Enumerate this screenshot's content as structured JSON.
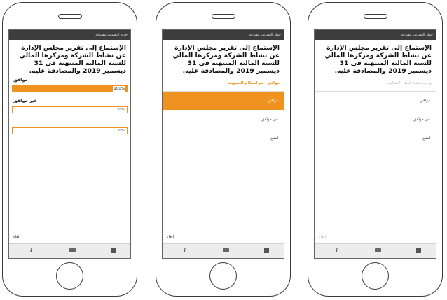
{
  "header_title": "جولة التصويت مفتوحة",
  "question": "الإستماع إلى تقرير مجلس الإدارة عن نشاط الشركة ومركزها المالي للسنة المالية المنتهية في 31 ديسمبر 2019 والمصادقة عليه.",
  "screen_results": {
    "results": [
      {
        "label": "موافق",
        "percent_text": "100%",
        "fraction": 1.0
      },
      {
        "label": "غير موافق",
        "percent_text": "0%",
        "fraction": 0.0
      },
      {
        "label": "",
        "percent_text": "0%",
        "fraction": 0.0
      }
    ]
  },
  "screen_confirmed": {
    "status": "موافق - تم استلام التصويت",
    "options": [
      "موافق",
      "غير موافق",
      "امتنع"
    ],
    "selected_index": 0
  },
  "screen_choose": {
    "prompt": "يرجى تحديد الخيار الانتخابي",
    "options": [
      "موافق",
      "غير موافق",
      "امتنع"
    ]
  },
  "cancel_label": "إلغاء",
  "colors": {
    "accent": "#f0921f",
    "header": "#3d3d3d"
  },
  "bottom_icons": [
    "info-icon",
    "chat-icon",
    "chart-icon"
  ]
}
